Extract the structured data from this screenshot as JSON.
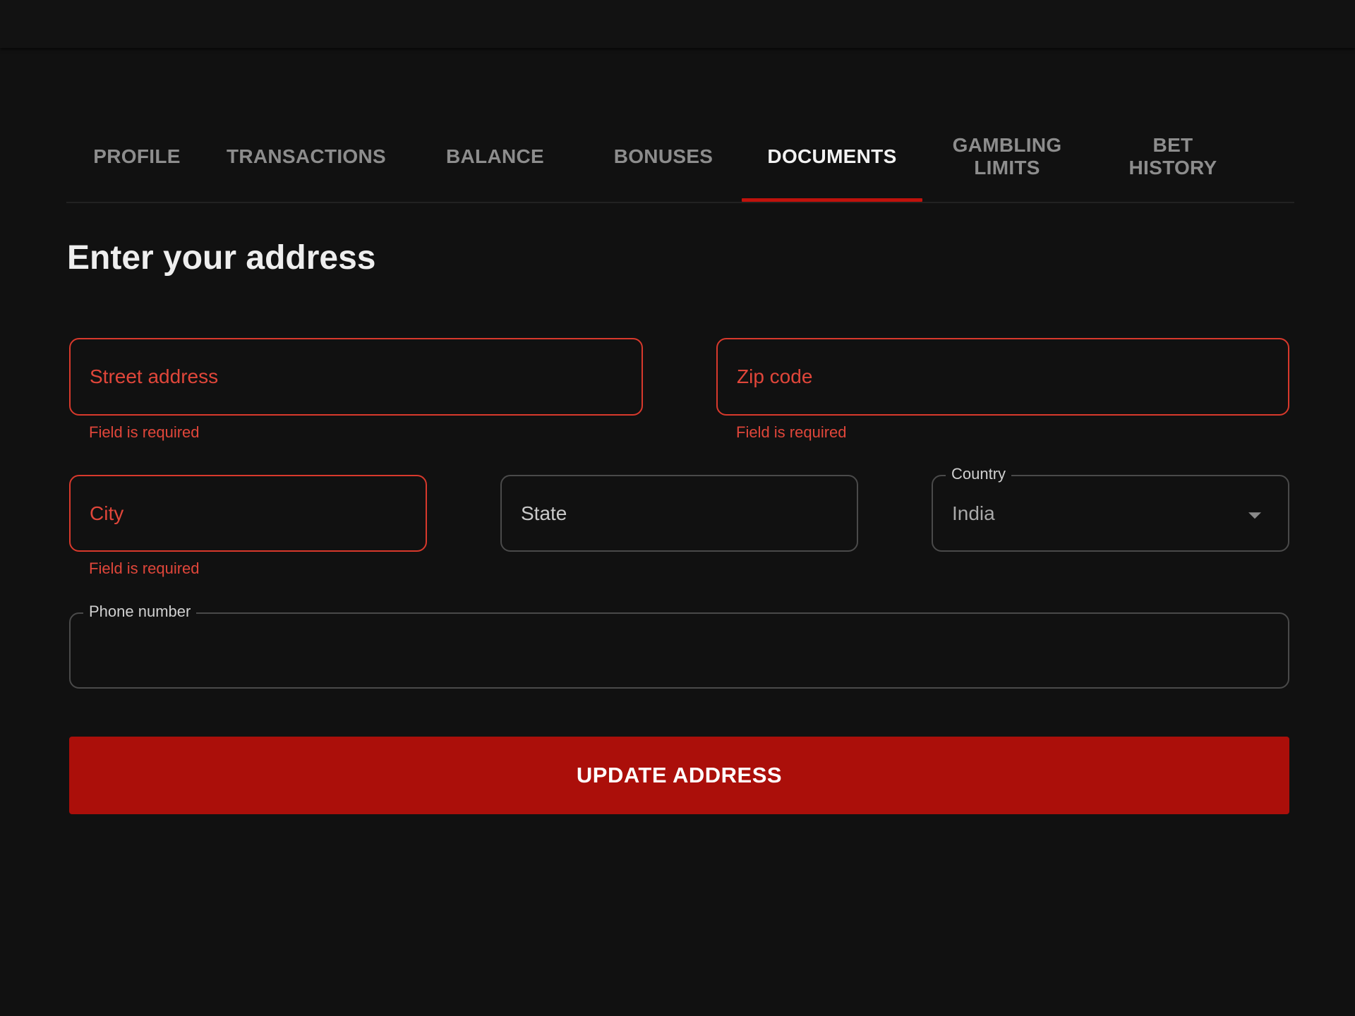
{
  "tabs": [
    {
      "label": "PROFILE",
      "active": false
    },
    {
      "label": "TRANSACTIONS",
      "active": false
    },
    {
      "label": "BALANCE",
      "active": false
    },
    {
      "label": "BONUSES",
      "active": false
    },
    {
      "label": "DOCUMENTS",
      "active": true
    },
    {
      "label": "GAMBLING LIMITS",
      "active": false
    },
    {
      "label": "BET HISTORY",
      "active": false
    }
  ],
  "form": {
    "title": "Enter your address",
    "street": {
      "placeholder": "Street address",
      "value": "",
      "error": "Field is required"
    },
    "zip": {
      "placeholder": "Zip code",
      "value": "",
      "error": "Field is required"
    },
    "city": {
      "placeholder": "City",
      "value": "",
      "error": "Field is required"
    },
    "state": {
      "placeholder": "State",
      "value": ""
    },
    "country": {
      "label": "Country",
      "value": "India"
    },
    "phone": {
      "label": "Phone number",
      "value": ""
    },
    "submit_label": "UPDATE ADDRESS"
  },
  "colors": {
    "accent": "#ab0f0a",
    "error": "#e0463a",
    "background": "#111111"
  }
}
